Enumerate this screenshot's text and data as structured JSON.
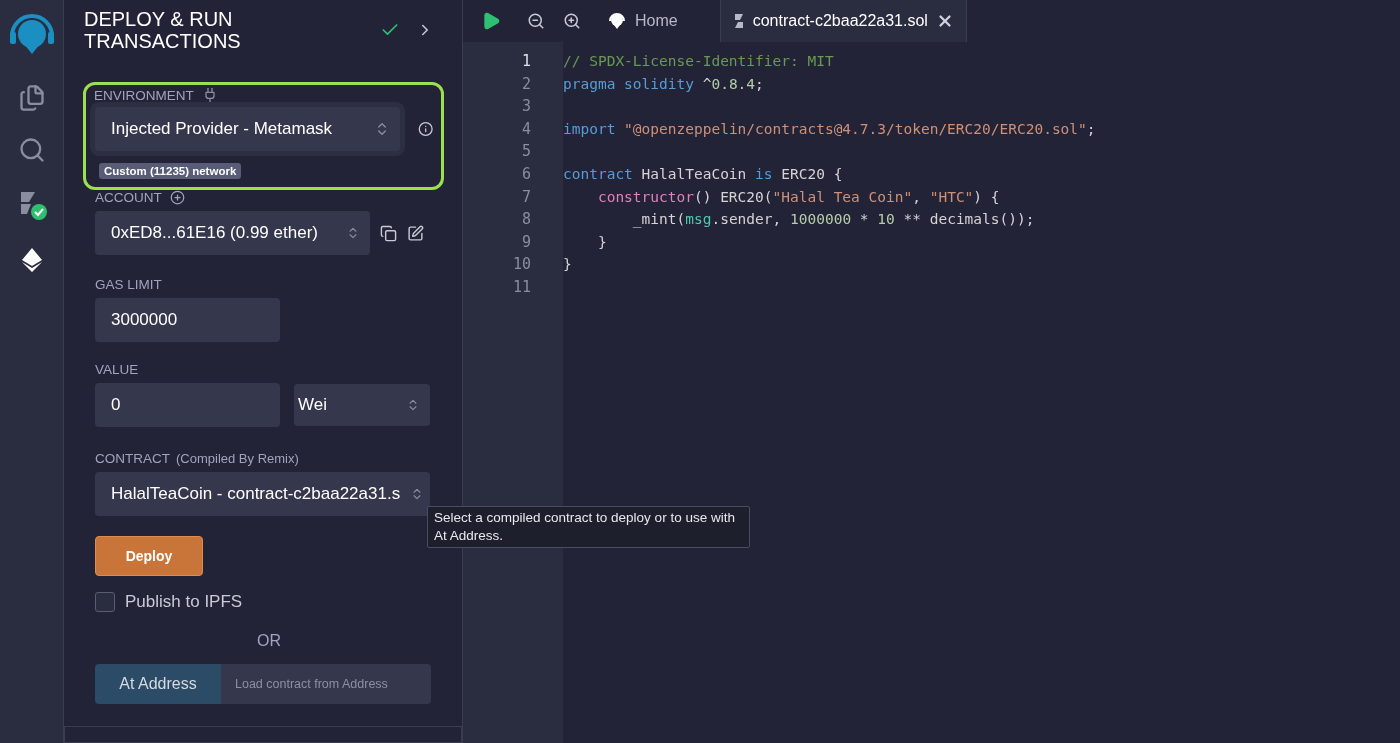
{
  "sidebar": {
    "items": [
      {
        "kind": "files",
        "selected": false
      },
      {
        "kind": "search",
        "selected": false
      },
      {
        "kind": "compiler",
        "selected": false
      },
      {
        "kind": "deploy",
        "selected": true
      }
    ]
  },
  "panel": {
    "title": "DEPLOY & RUN TRANSACTIONS",
    "environment": {
      "label": "ENVIRONMENT",
      "value": "Injected Provider - Metamask",
      "network": "Custom (11235) network",
      "highlighted": true
    },
    "account": {
      "label": "ACCOUNT",
      "value": "0xED8...61E16 (0.99 ether)"
    },
    "gas_limit": {
      "label": "GAS LIMIT",
      "value": "3000000"
    },
    "value": {
      "label": "VALUE",
      "amount": "0",
      "unit": "Wei"
    },
    "contract": {
      "label": "CONTRACT",
      "note": "(Compiled By Remix)",
      "value": "HalalTeaCoin - contract-c2baa22a31.s"
    },
    "deploy_button": "Deploy",
    "publish": {
      "label": "Publish to IPFS",
      "checked": false
    },
    "or_text": "OR",
    "at_address": {
      "button": "At Address",
      "placeholder": "Load contract from Address"
    }
  },
  "tooltip": "Select a compiled contract to deploy or to use with At Address.",
  "editor": {
    "tabs": [
      {
        "kind": "home",
        "label": "Home",
        "selected": false
      },
      {
        "kind": "file",
        "label": "contract-c2baa22a31.sol",
        "selected": true
      }
    ],
    "lines": [
      {
        "number": "1",
        "tokens": [
          {
            "text": "// SPDX-License-Identifier: MIT",
            "kind": "comment"
          }
        ]
      },
      {
        "number": "2",
        "tokens": [
          {
            "text": "pragma solidity",
            "kind": "keyword"
          },
          {
            "text": " ^",
            "kind": "plain"
          },
          {
            "text": "0.8.4",
            "kind": "number"
          },
          {
            "text": ";",
            "kind": "plain"
          }
        ]
      },
      {
        "number": "3"
      },
      {
        "number": "4",
        "tokens": [
          {
            "text": "import",
            "kind": "keyword"
          },
          {
            "text": " \"@openzeppelin/contracts@4.7.3/token/ERC20/ERC20.sol\"",
            "kind": "string"
          },
          {
            "text": ";",
            "kind": "plain"
          }
        ]
      },
      {
        "number": "5"
      },
      {
        "number": "6",
        "tokens": [
          {
            "text": "contract",
            "kind": "keyword"
          },
          {
            "text": " HalalTeaCoin ",
            "kind": "plain"
          },
          {
            "text": "is",
            "kind": "keyword"
          },
          {
            "text": " ERC20 {",
            "kind": "plain"
          }
        ]
      },
      {
        "number": "7",
        "tokens": [
          {
            "text": "    constructor",
            "kind": "function"
          },
          {
            "text": "() ERC20(",
            "kind": "plain"
          },
          {
            "text": "\"Halal Tea Coin\"",
            "kind": "string"
          },
          {
            "text": ", ",
            "kind": "plain"
          },
          {
            "text": "\"HTC\"",
            "kind": "string"
          },
          {
            "text": ") {",
            "kind": "plain"
          }
        ]
      },
      {
        "number": "8",
        "tokens": [
          {
            "text": "        _mint(",
            "kind": "plain"
          },
          {
            "text": "msg",
            "kind": "builtin"
          },
          {
            "text": ".sender, ",
            "kind": "plain"
          },
          {
            "text": "1000000",
            "kind": "number"
          },
          {
            "text": " * ",
            "kind": "plain"
          },
          {
            "text": "10",
            "kind": "number"
          },
          {
            "text": " ** decimals());",
            "kind": "plain"
          }
        ]
      },
      {
        "number": "9",
        "tokens": [
          {
            "text": "    }",
            "kind": "plain"
          }
        ]
      },
      {
        "number": "10",
        "tokens": [
          {
            "text": "}",
            "kind": "plain"
          }
        ]
      },
      {
        "number": "11"
      }
    ]
  }
}
